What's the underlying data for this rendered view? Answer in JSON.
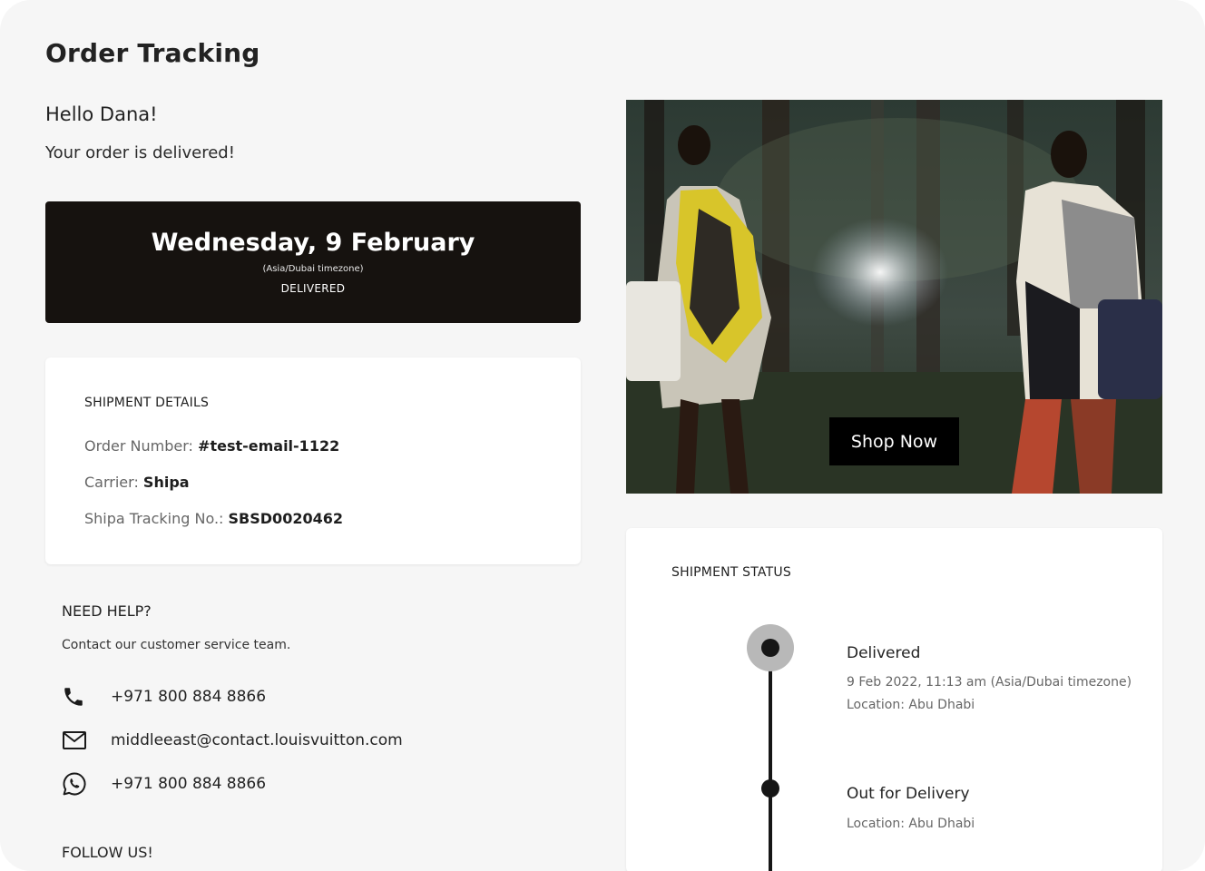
{
  "page": {
    "title": "Order Tracking"
  },
  "greeting": "Hello Dana!",
  "status_message": "Your order is delivered!",
  "delivery": {
    "date": "Wednesday, 9 February",
    "timezone": "(Asia/Dubai timezone)",
    "status": "DELIVERED"
  },
  "shipment_details": {
    "heading": "SHIPMENT DETAILS",
    "rows": [
      {
        "label": "Order Number: ",
        "value": "#test-email-1122"
      },
      {
        "label": "Carrier: ",
        "value": "Shipa"
      },
      {
        "label": "Shipa Tracking No.: ",
        "value": "SBSD0020462"
      }
    ]
  },
  "help": {
    "heading": "NEED HELP?",
    "subtitle": "Contact our customer service team.",
    "contacts": [
      {
        "icon": "phone-icon",
        "value": "+971 800 884 8866"
      },
      {
        "icon": "mail-icon",
        "value": "middleeast@contact.louisvuitton.com"
      },
      {
        "icon": "whatsapp-icon",
        "value": "+971 800 884 8866"
      }
    ]
  },
  "follow": {
    "heading": "FOLLOW US!"
  },
  "hero": {
    "button_label": "Shop Now"
  },
  "shipment_status": {
    "heading": "SHIPMENT STATUS",
    "steps": [
      {
        "title": "Delivered",
        "time": "9 Feb 2022, 11:13 am (Asia/Dubai timezone)",
        "location": "Location: Abu Dhabi"
      },
      {
        "title": "Out for Delivery",
        "location": "Location: Abu Dhabi"
      }
    ]
  },
  "colors": {
    "background": "#f6f6f6",
    "card": "#ffffff",
    "dark": "#16120f",
    "accent": "#000000"
  }
}
